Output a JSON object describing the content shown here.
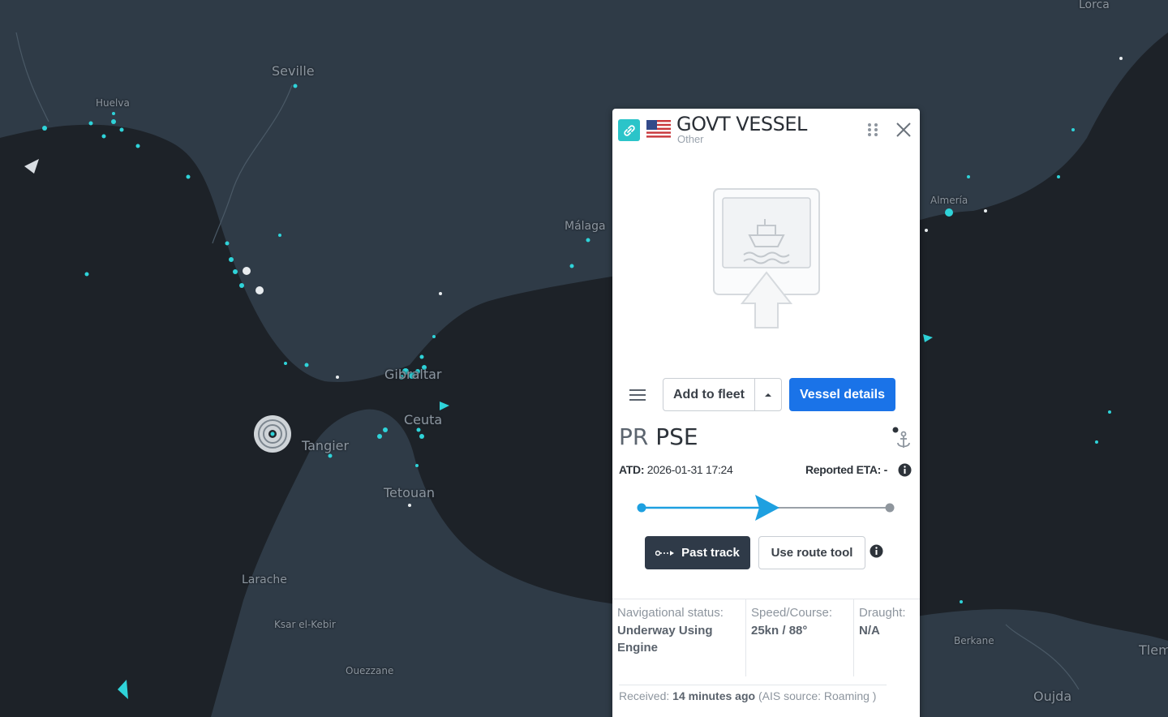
{
  "map": {
    "cities": [
      {
        "name": "Lorca"
      },
      {
        "name": "Seville"
      },
      {
        "name": "Huelva"
      },
      {
        "name": "Málaga"
      },
      {
        "name": "Almería"
      },
      {
        "name": "Gibraltar"
      },
      {
        "name": "Ceuta"
      },
      {
        "name": "Tangier"
      },
      {
        "name": "Tetouan"
      },
      {
        "name": "Larache"
      },
      {
        "name": "Ksar el-Kebir"
      },
      {
        "name": "Ouezzane"
      },
      {
        "name": "Berkane"
      },
      {
        "name": "Oujda"
      },
      {
        "name": "Tlem"
      }
    ],
    "colors": {
      "sea": "#1d2228",
      "land": "#2f3b47",
      "vessel": "#2fd3d9"
    }
  },
  "panel": {
    "name": "GOVT VESSEL",
    "type": "Other",
    "flag": "us-flag",
    "icons": [
      "link-icon",
      "drag-handle-icon",
      "close-icon",
      "ship-placeholder-icon",
      "menu-icon",
      "anchor-icon",
      "info-icon"
    ],
    "toolbar": {
      "add_to_fleet": "Add to fleet",
      "vessel_details": "Vessel details"
    },
    "route": {
      "from": "PR",
      "to": "PSE"
    },
    "atd_label": "ATD:",
    "atd_value": "2026-01-31 17:24",
    "eta_text": "Reported ETA: -",
    "progress": 0.5,
    "past_track": "Past track",
    "route_tool": "Use route tool",
    "stats": {
      "nav_label": "Navigational status:",
      "nav_value": "Underway Using Engine",
      "speed_label": "Speed/Course:",
      "speed_value": "25kn / 88°",
      "draught_label": "Draught:",
      "draught_value": "N/A"
    },
    "received_label": "Received:",
    "received_value": "14 minutes ago",
    "received_source": "(AIS source: Roaming )",
    "accent_color": "#1a73e8"
  }
}
